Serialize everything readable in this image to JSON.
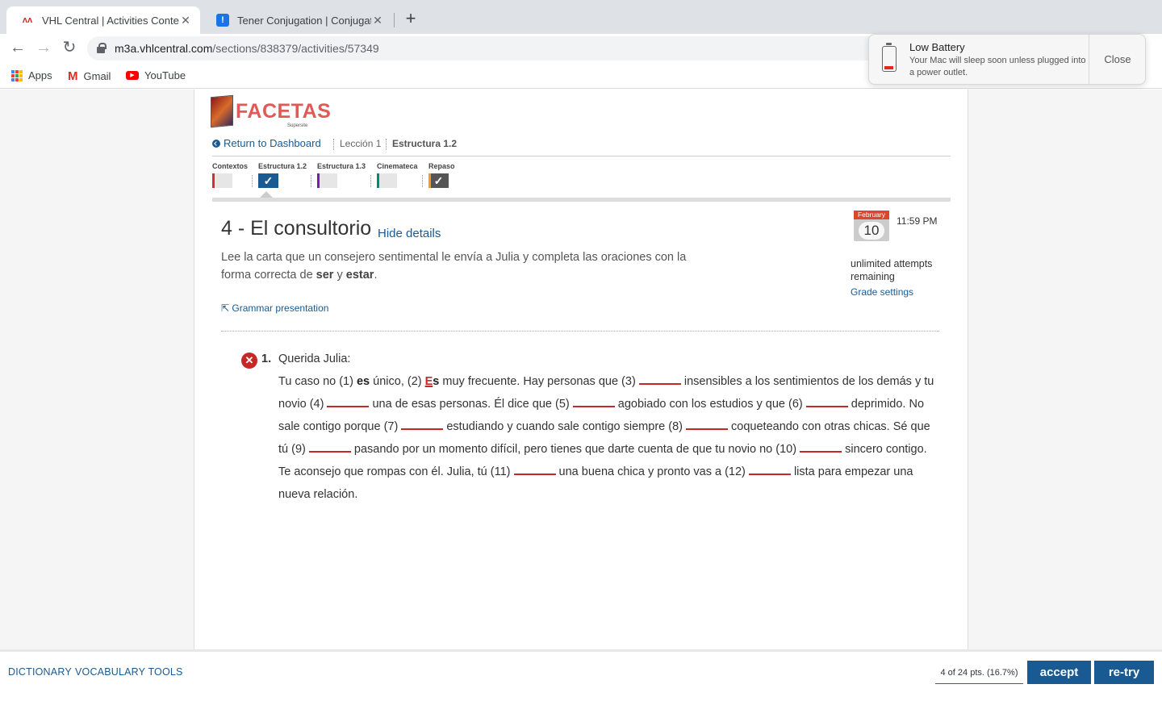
{
  "browser": {
    "tabs": [
      {
        "title": "VHL Central | Activities Content",
        "active": true,
        "favicon": "vhl-icon"
      },
      {
        "title": "Tener Conjugation | Conjugate",
        "active": false,
        "favicon": "info-icon"
      }
    ],
    "new_tab": "+",
    "url_host": "m3a.vhlcentral.com",
    "url_path": "/sections/838379/activities/57349",
    "bookmarks": [
      "Apps",
      "Gmail",
      "YouTube"
    ]
  },
  "notification": {
    "title": "Low Battery",
    "body": "Your Mac will sleep soon unless plugged into a power outlet.",
    "close": "Close",
    "icon": "battery-low-icon"
  },
  "logo": {
    "word": "FACETAS",
    "sub": "Supersite"
  },
  "breadcrumb": {
    "back": "Return to Dashboard",
    "lesson": "Lección 1",
    "current": "Estructura 1.2"
  },
  "sections": [
    {
      "label": "Contextos",
      "color": "#d32f2f",
      "checked": false
    },
    {
      "label": "Estructura 1.2",
      "color": "#1a5a92",
      "checked": true
    },
    {
      "label": "Estructura 1.3",
      "color": "#7b1fa2",
      "checked": false
    },
    {
      "label": "Cinemateca",
      "color": "#00897b",
      "checked": false
    },
    {
      "label": "Repaso",
      "color": "#f59c1a",
      "checked": true
    }
  ],
  "activity": {
    "title": "4 - El consultorio",
    "hide_details": "Hide details",
    "instructions_pre": "Lee la carta que un consejero sentimental le envía a Julia y completa las oraciones con la forma correcta de ",
    "word1": "ser",
    "conj": " y ",
    "word2": "estar",
    "period": ".",
    "grammar_link": "Grammar presentation",
    "due_month": "February",
    "due_day": "10",
    "due_time": "11:59 PM",
    "attempts": "unlimited attempts remaining",
    "grade_settings": "Grade settings"
  },
  "question": {
    "number": "1.",
    "greeting": "Querida Julia:",
    "t1": "Tu caso no (1) ",
    "a1": "es",
    "t2": " único, (2) ",
    "a2_first": "E",
    "a2_rest": "s",
    "t3": " muy frecuente. Hay personas que (3) ",
    "t4": " insensibles a los sentimientos de los demás y tu novio (4) ",
    "t5": " una de esas personas. Él dice que (5) ",
    "t6": " agobiado con los estudios y que (6) ",
    "t7": " deprimido. No sale contigo porque (7) ",
    "t8": " estudiando y cuando sale contigo siempre (8) ",
    "t9": " coqueteando con otras chicas. Sé que tú (9) ",
    "t10": " pasando por un momento difícil, pero tienes que darte cuenta de que tu novio no (10) ",
    "t11": " sincero contigo. Te aconsejo que rompas con él. Julia, tú (11) ",
    "t12": " una buena chica y pronto vas a (12) ",
    "t13": " lista para empezar una nueva relación."
  },
  "footer": {
    "dictionary": "DICTIONARY",
    "vocab": "VOCABULARY TOOLS",
    "score": "4 of 24 pts. (16.7%)",
    "accept": "accept",
    "retry": "re-try"
  }
}
